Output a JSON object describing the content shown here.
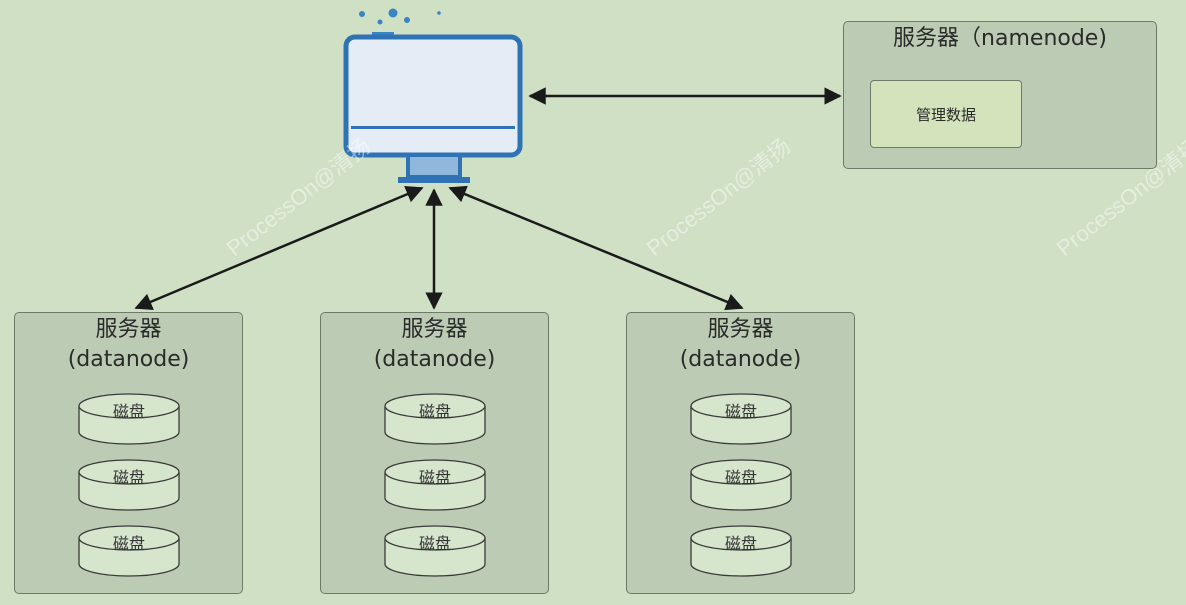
{
  "namenode": {
    "title": "服务器（namenode)",
    "management_label": "管理数据"
  },
  "datanodes": [
    {
      "title_line1": "服务器",
      "title_line2": "(datanode)",
      "disks": [
        "磁盘",
        "磁盘",
        "磁盘"
      ]
    },
    {
      "title_line1": "服务器",
      "title_line2": "(datanode)",
      "disks": [
        "磁盘",
        "磁盘",
        "磁盘"
      ]
    },
    {
      "title_line1": "服务器",
      "title_line2": "(datanode)",
      "disks": [
        "磁盘",
        "磁盘",
        "磁盘"
      ]
    }
  ],
  "watermark": "ProcessOn@清扬",
  "colors": {
    "background": "#cfe0c5",
    "server_fill": "#bcccb4",
    "monitor_blue": "#2f73b5",
    "screen_fill": "#e4edf5",
    "stand_light": "#8fb8dc",
    "arrow": "#1a1a1a"
  },
  "icons": {
    "client": "desktop-monitor-icon",
    "disk": "disk-cylinder-icon"
  }
}
